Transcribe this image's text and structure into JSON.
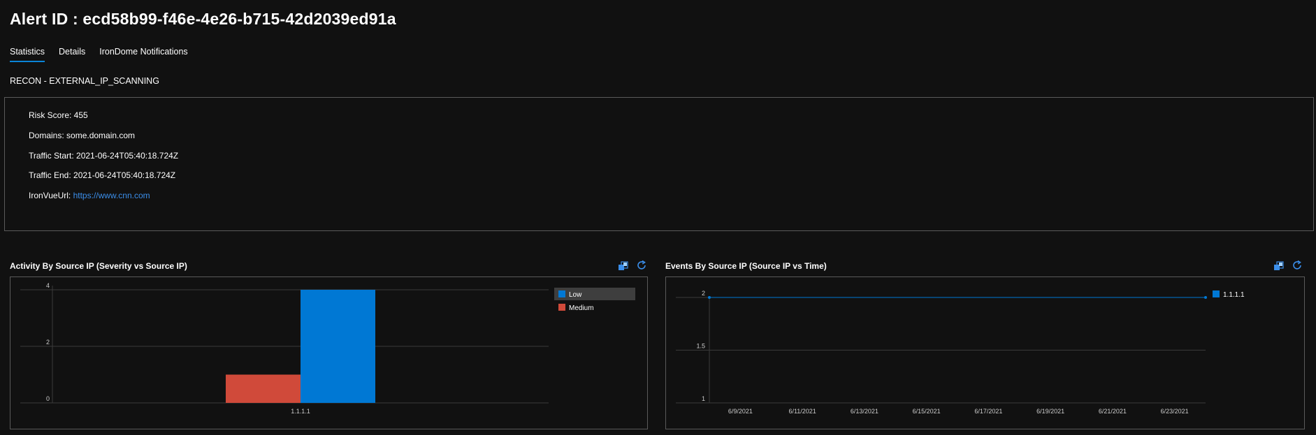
{
  "header": {
    "title": "Alert ID : ecd58b99-f46e-4e26-b715-42d2039ed91a"
  },
  "tabs": [
    {
      "label": "Statistics",
      "active": true
    },
    {
      "label": "Details",
      "active": false
    },
    {
      "label": "IronDome Notifications",
      "active": false
    }
  ],
  "alert_type": "RECON - EXTERNAL_IP_SCANNING",
  "info": {
    "risk_score": "Risk Score: 455",
    "domains": "Domains: some.domain.com",
    "traffic_start": "Traffic Start: 2021-06-24T05:40:18.724Z",
    "traffic_end": "Traffic End: 2021-06-24T05:40:18.724Z",
    "ironvue_label": "IronVueUrl: ",
    "ironvue_url": "https://www.cnn.com"
  },
  "panels": {
    "activity": {
      "title": "Activity By Source IP (Severity vs Source IP)",
      "icons": [
        "focus-mode-icon",
        "refresh-icon"
      ]
    },
    "events": {
      "title": "Events By Source IP (Source IP vs Time)",
      "icons": [
        "focus-mode-icon",
        "refresh-icon"
      ]
    }
  },
  "colors": {
    "accent": "#0a84d8",
    "low": "#0078d4",
    "medium": "#d04a3a",
    "link": "#3b8eea"
  },
  "chart_data": [
    {
      "type": "bar",
      "title": "Activity By Source IP (Severity vs Source IP)",
      "categories": [
        "1.1.1.1"
      ],
      "series": [
        {
          "name": "Medium",
          "values": [
            1
          ],
          "color": "#d04a3a"
        },
        {
          "name": "Low",
          "values": [
            4
          ],
          "color": "#0078d4"
        }
      ],
      "yticks": [
        "0",
        "2",
        "4"
      ],
      "ylim": [
        0,
        4
      ],
      "legend": [
        "Low",
        "Medium"
      ],
      "legend_position": "top-right",
      "grid": true
    },
    {
      "type": "line",
      "title": "Events By Source IP (Source IP vs Time)",
      "xticks": [
        "6/9/2021",
        "6/11/2021",
        "6/13/2021",
        "6/15/2021",
        "6/17/2021",
        "6/19/2021",
        "6/21/2021",
        "6/23/2021"
      ],
      "xlim": [
        "2021-06-08",
        "2021-06-24"
      ],
      "series": [
        {
          "name": "1.1.1.1",
          "points": [
            {
              "x": "2021-06-08",
              "y": 2
            },
            {
              "x": "2021-06-24",
              "y": 2
            }
          ],
          "color": "#0078d4"
        }
      ],
      "yticks": [
        "1",
        "1.5",
        "2"
      ],
      "ylim": [
        1,
        2
      ],
      "legend": [
        "1.1.1.1"
      ],
      "legend_position": "top-right",
      "grid": true
    }
  ]
}
